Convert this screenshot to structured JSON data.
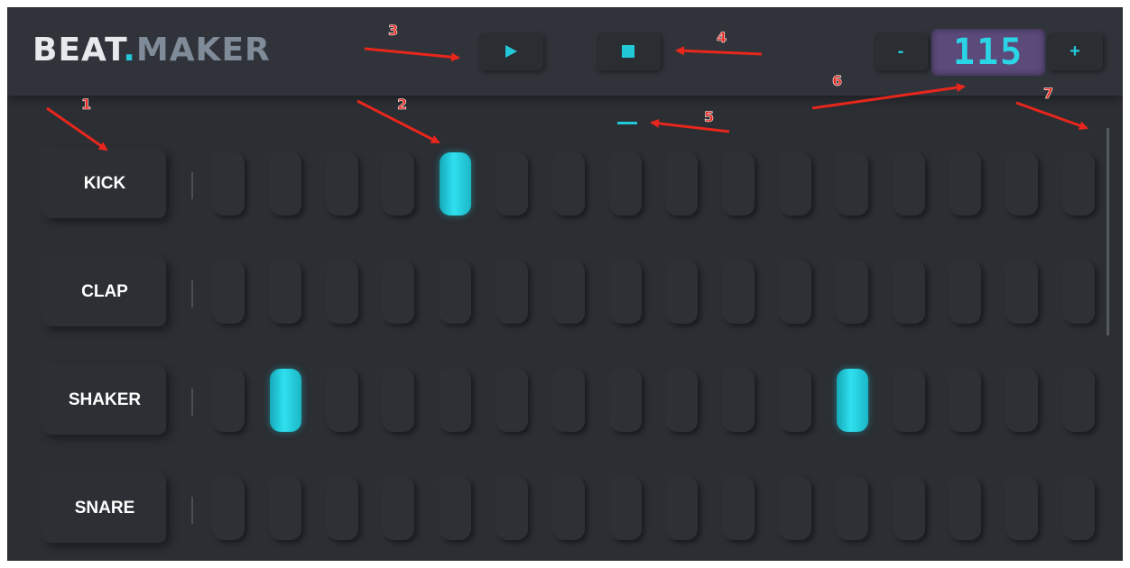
{
  "app": {
    "logo_part1": "BEAT",
    "logo_dot": ".",
    "logo_part2": "MAKER"
  },
  "header": {
    "play_icon": "play-icon",
    "stop_icon": "stop-icon",
    "tempo_minus_label": "-",
    "tempo_value": "115",
    "tempo_plus_label": "+"
  },
  "tracks": [
    {
      "name": "KICK",
      "steps": [
        0,
        0,
        0,
        0,
        1,
        0,
        0,
        0,
        0,
        0,
        0,
        0,
        0,
        0,
        0,
        0
      ]
    },
    {
      "name": "CLAP",
      "steps": [
        0,
        0,
        0,
        0,
        0,
        0,
        0,
        0,
        0,
        0,
        0,
        0,
        0,
        0,
        0,
        0
      ]
    },
    {
      "name": "SHAKER",
      "steps": [
        0,
        1,
        0,
        0,
        0,
        0,
        0,
        0,
        0,
        0,
        0,
        1,
        0,
        0,
        0,
        0
      ]
    },
    {
      "name": "SNARE",
      "steps": [
        0,
        0,
        0,
        0,
        0,
        0,
        0,
        0,
        0,
        0,
        0,
        0,
        0,
        0,
        0,
        0
      ]
    }
  ],
  "annotations": [
    "1",
    "2",
    "3",
    "4",
    "5",
    "6",
    "7"
  ],
  "colors": {
    "accent": "#22c8d8",
    "background": "#2b2e33",
    "tempo_display": "#5b4a7a",
    "annotation": "#e8261c"
  }
}
